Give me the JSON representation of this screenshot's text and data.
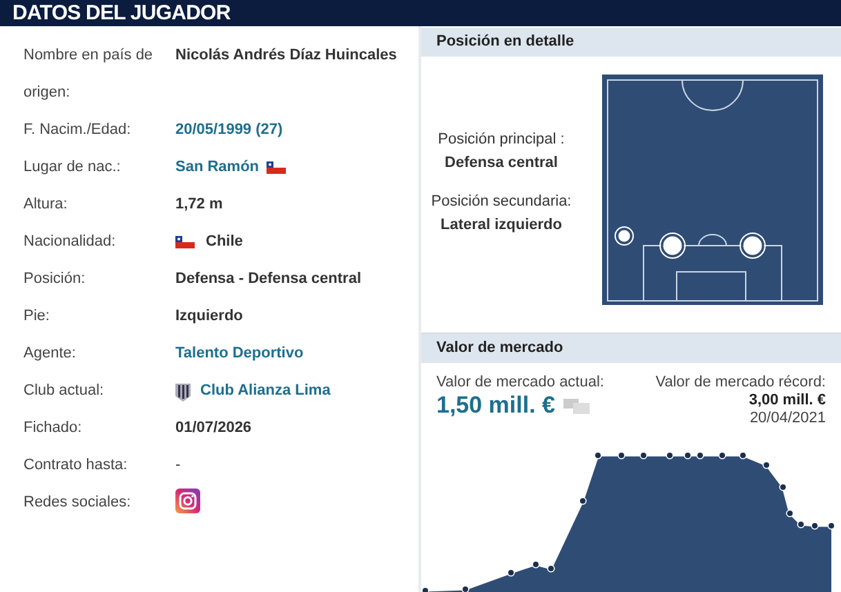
{
  "header": {
    "title": "DATOS DEL JUGADOR"
  },
  "player_data": [
    {
      "label": "Nombre en país de origen:",
      "value": "Nicolás Andrés Díaz Huincales",
      "kind": "text"
    },
    {
      "label": "F. Nacim./Edad:",
      "value": "20/05/1999 (27)",
      "kind": "link"
    },
    {
      "label": "Lugar de nac.:",
      "value": "San Ramón",
      "kind": "link_flag"
    },
    {
      "label": "Altura:",
      "value": "1,72 m",
      "kind": "text"
    },
    {
      "label": "Nacionalidad:",
      "value": "Chile",
      "kind": "flag_text"
    },
    {
      "label": "Posición:",
      "value": "Defensa - Defensa central",
      "kind": "text"
    },
    {
      "label": "Pie:",
      "value": "Izquierdo",
      "kind": "text"
    },
    {
      "label": "Agente:",
      "value": "Talento Deportivo",
      "kind": "link"
    },
    {
      "label": "Club actual:",
      "value": "Club Alianza Lima",
      "kind": "club_link"
    },
    {
      "label": "Fichado:",
      "value": "01/07/2026",
      "kind": "text"
    },
    {
      "label": "Contrato hasta:",
      "value": "-",
      "kind": "plain"
    },
    {
      "label": "Redes sociales:",
      "kind": "social"
    }
  ],
  "position": {
    "title": "Posición en detalle",
    "main_label": "Posición principal :",
    "main": "Defensa central",
    "secondary_label": "Posición secundaria:",
    "secondary": "Lateral izquierdo"
  },
  "market_value": {
    "title": "Valor de mercado",
    "current_label": "Valor de mercado actual:",
    "current_value": "1,50 mill. €",
    "record_label": "Valor de mercado récord:",
    "record_value": "3,00 mill. €",
    "record_date": "20/04/2021"
  }
}
